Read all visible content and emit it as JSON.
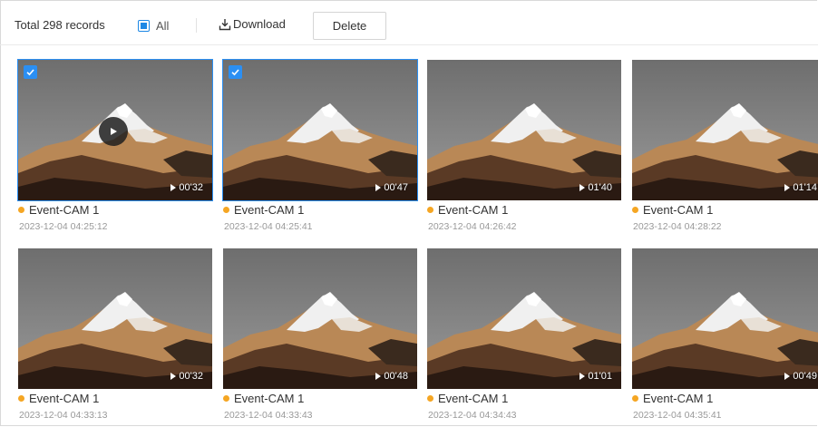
{
  "toolbar": {
    "total": "Total 298 records",
    "select_all_label": "All",
    "download_label": "Download",
    "delete_label": "Delete"
  },
  "records": [
    {
      "title": "Event-CAM 1",
      "time": "2023-12-04 04:25:12",
      "duration": "00'32",
      "selected": true,
      "show_play": true
    },
    {
      "title": "Event-CAM 1",
      "time": "2023-12-04 04:25:41",
      "duration": "00'47",
      "selected": true,
      "show_play": false
    },
    {
      "title": "Event-CAM 1",
      "time": "2023-12-04 04:26:42",
      "duration": "01'40",
      "selected": false,
      "show_play": false
    },
    {
      "title": "Event-CAM 1",
      "time": "2023-12-04 04:28:22",
      "duration": "01'14",
      "selected": false,
      "show_play": false
    },
    {
      "title": "Event-CAM 1",
      "time": "2023-12-04 04:33:13",
      "duration": "00'32",
      "selected": false,
      "show_play": false
    },
    {
      "title": "Event-CAM 1",
      "time": "2023-12-04 04:33:43",
      "duration": "00'48",
      "selected": false,
      "show_play": false
    },
    {
      "title": "Event-CAM 1",
      "time": "2023-12-04 04:34:43",
      "duration": "01'01",
      "selected": false,
      "show_play": false
    },
    {
      "title": "Event-CAM 1",
      "time": "2023-12-04 04:35:41",
      "duration": "00'49",
      "selected": false,
      "show_play": false
    }
  ],
  "colors": {
    "accent": "#2b8ff3",
    "status_dot": "#f5a623",
    "sky": "#7d7d7d",
    "mountain_lit": "#c9935f",
    "snow": "#f2f2f2"
  },
  "icons": {
    "select_all": "checkbox-icon",
    "download": "download-icon",
    "play": "play-icon",
    "duration": "play-small-icon",
    "selected": "checkmark-icon"
  }
}
